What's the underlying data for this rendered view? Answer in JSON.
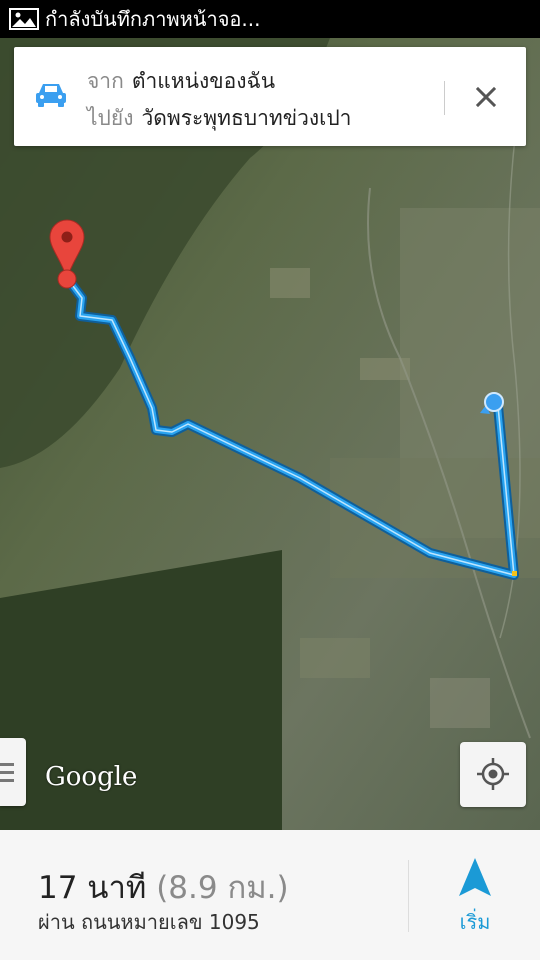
{
  "status_bar": {
    "icon": "image-icon",
    "text": "กำลังบันทึกภาพหน้าจอ..."
  },
  "route_card": {
    "mode_icon": "car-icon",
    "from_label": "จาก",
    "from_value": "ตำแหน่งของฉัน",
    "to_label": "ไปยัง",
    "to_value": "วัดพระพุทธบาทข่วงเปา",
    "close_icon": "close-icon"
  },
  "map": {
    "attribution": "Google",
    "route_color": "#29a3f0",
    "pin_color": "#e8453c",
    "location_dot_color": "#3b9ff0"
  },
  "bottom_panel": {
    "eta": "17 นาที",
    "distance": "(8.9 กม.)",
    "via": "ผ่าน ถนนหมายเลข 1095",
    "start_label": "เริ่ม",
    "accent": "#1b9ad6"
  }
}
